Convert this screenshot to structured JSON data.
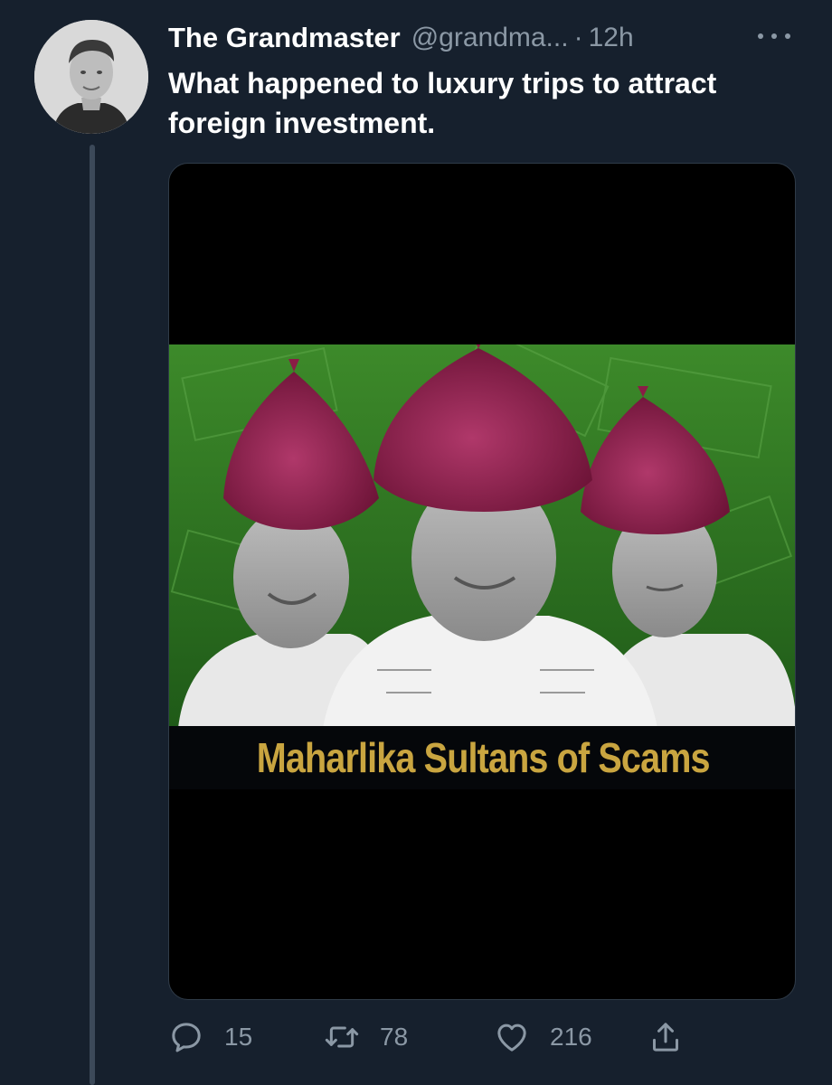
{
  "tweet": {
    "author": {
      "display_name": "The Grandmaster",
      "handle": "@grandma...",
      "avatar_icon": "profile-photo"
    },
    "separator": "·",
    "timestamp": "12h",
    "more_icon": "more-horizontal-icon",
    "text": "What happened to luxury trips to attract foreign investment."
  },
  "media": {
    "caption": "Maharlika Sultans of Scams",
    "caption_color": "#c9a540",
    "background_color": "#000000"
  },
  "actions": {
    "reply": {
      "icon": "reply-icon",
      "count": "15"
    },
    "retweet": {
      "icon": "retweet-icon",
      "count": "78"
    },
    "like": {
      "icon": "heart-icon",
      "count": "216"
    },
    "share": {
      "icon": "share-icon"
    }
  },
  "colors": {
    "background": "#16202d",
    "secondary_text": "#8b98a5",
    "primary_text": "#ffffff"
  }
}
